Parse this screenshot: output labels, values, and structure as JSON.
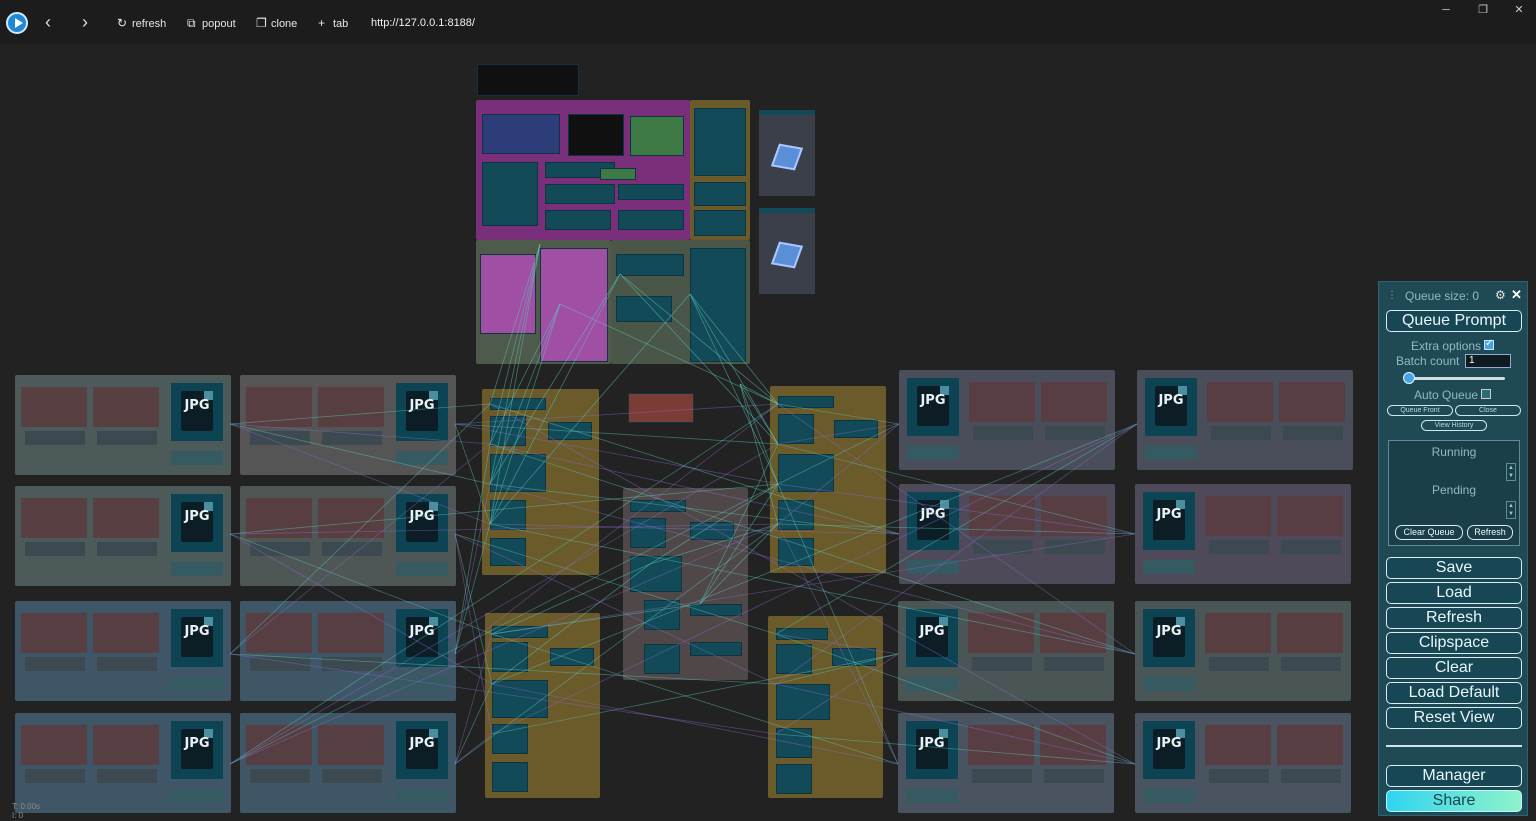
{
  "toolbar": {
    "refresh_label": "refresh",
    "popout_label": "popout",
    "clone_label": "clone",
    "tab_label": "tab",
    "url": "http://127.0.0.1:8188/",
    "icons": [
      "app-logo-icon",
      "back-icon",
      "forward-icon",
      "refresh-icon",
      "popout-icon",
      "clone-icon",
      "plus-icon",
      "minimize-icon",
      "restore-icon",
      "close-icon"
    ]
  },
  "canvas": {
    "jpg_label": "JPG",
    "status_time": "T: 0.00s",
    "status_index": "I: 0",
    "colors": {
      "background": "#222222",
      "node": "#134a58",
      "group_olive": "#6b5a2a",
      "group_slate": "#4a4e5a",
      "group_magenta": "#8a3a8a",
      "wire": "#5fd0c0"
    }
  },
  "menu": {
    "queue_size": "Queue size: 0",
    "queue_prompt": "Queue Prompt",
    "extra_options": "Extra options",
    "extra_options_checked": true,
    "batch_count_label": "Batch count",
    "batch_count_value": "1",
    "auto_queue": "Auto Queue",
    "auto_queue_checked": false,
    "queue_front": "Queue Front",
    "close": "Close",
    "view_history": "View History",
    "running": "Running",
    "pending": "Pending",
    "clear_queue": "Clear Queue",
    "refresh_small": "Refresh",
    "buttons": [
      "Save",
      "Load",
      "Refresh",
      "Clipspace",
      "Clear",
      "Load Default",
      "Reset View"
    ],
    "manager": "Manager",
    "share": "Share"
  }
}
